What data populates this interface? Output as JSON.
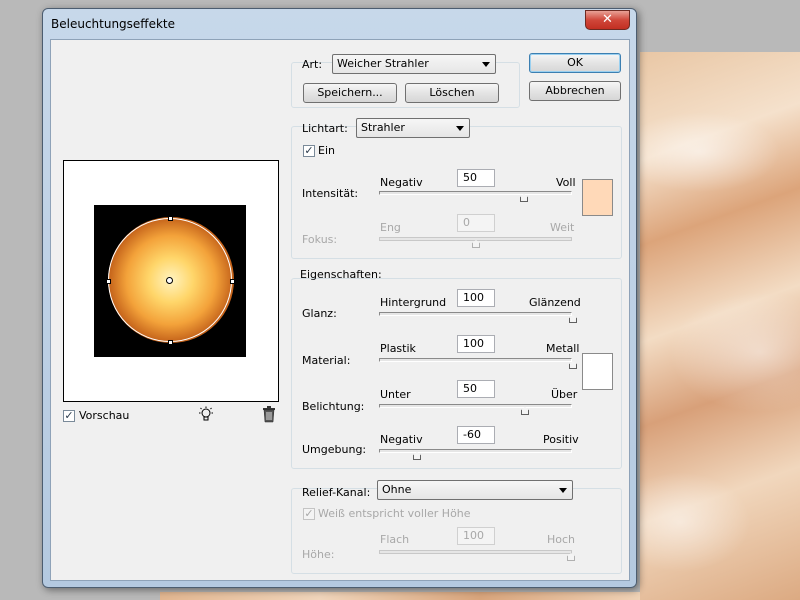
{
  "window": {
    "title": "Beleuchtungseffekte",
    "close_glyph": "✕"
  },
  "colors": {
    "light_color": "#ffd9b8",
    "material_color": "#ffffff",
    "accent": "#3c7fb1"
  },
  "preview": {
    "checkbox_glyph": "✓",
    "label": "Vorschau",
    "bulb_icon": "lightbulb-icon",
    "trash_icon": "trash-icon"
  },
  "style_group": {
    "label": "Art:",
    "value": "Weicher Strahler",
    "save_label": "Speichern...",
    "delete_label": "Löschen"
  },
  "buttons": {
    "ok": "OK",
    "cancel": "Abbrechen"
  },
  "light_type": {
    "label": "Lichtart:",
    "value": "Strahler",
    "on_label": "Ein",
    "on_glyph": "✓",
    "intensity": {
      "label": "Intensität:",
      "left": "Negativ",
      "right": "Voll",
      "value": "50",
      "level": 50
    },
    "focus": {
      "label": "Fokus:",
      "left": "Eng",
      "right": "Weit",
      "value": "0",
      "level": 0
    }
  },
  "properties": {
    "label": "Eigenschaften:",
    "gloss": {
      "label": "Glanz:",
      "left": "Hintergrund",
      "right": "Glänzend",
      "value": "100",
      "level": 100
    },
    "material": {
      "label": "Material:",
      "left": "Plastik",
      "right": "Metall",
      "value": "100",
      "level": 100
    },
    "exposure": {
      "label": "Belichtung:",
      "left": "Unter",
      "right": "Über",
      "value": "50",
      "level": 50
    },
    "ambience": {
      "label": "Umgebung:",
      "left": "Negativ",
      "right": "Positiv",
      "value": "-60",
      "level": -60
    }
  },
  "texture": {
    "label": "Relief-Kanal:",
    "value": "Ohne",
    "white_high_label": "Weiß entspricht voller Höhe",
    "white_high_glyph": "✓",
    "height": {
      "label": "Höhe:",
      "left": "Flach",
      "right": "Hoch",
      "value": "100",
      "level": 100
    }
  }
}
